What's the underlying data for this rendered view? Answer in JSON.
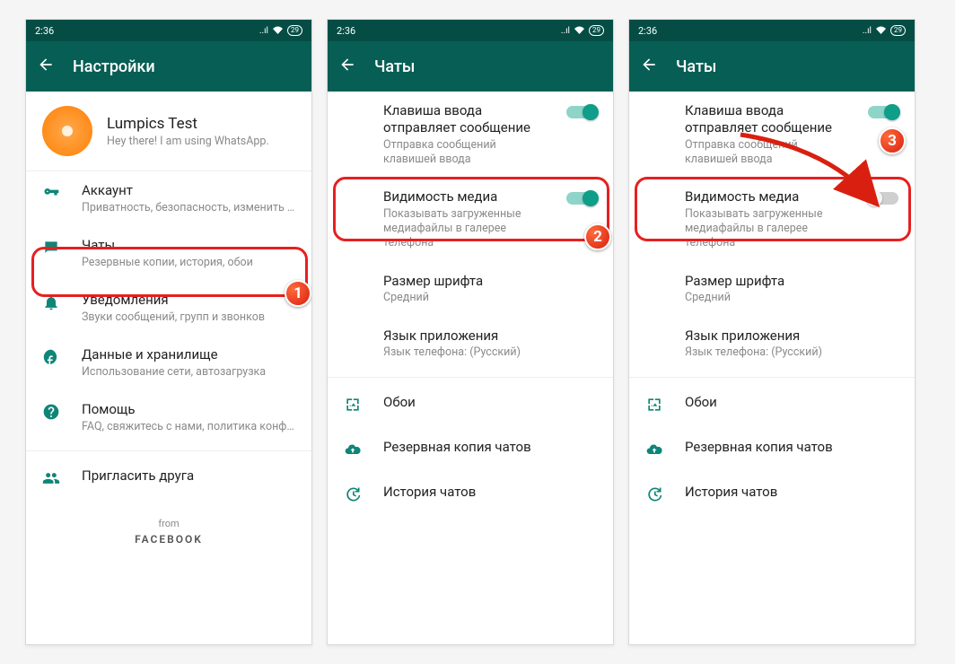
{
  "status": {
    "time": "2:36",
    "battery": "29"
  },
  "screen1": {
    "title": "Настройки",
    "profile": {
      "name": "Lumpics Test",
      "sub": "Hey there! I am using WhatsApp."
    },
    "items": [
      {
        "title": "Аккаунт",
        "sub": "Приватность, безопасность, изменить номер"
      },
      {
        "title": "Чаты",
        "sub": "Резервные копии, история, обои"
      },
      {
        "title": "Уведомления",
        "sub": "Звуки сообщений, групп и звонков"
      },
      {
        "title": "Данные и хранилище",
        "sub": "Использование сети, автозагрузка"
      },
      {
        "title": "Помощь",
        "sub": "FAQ, свяжитесь с нами, политика конфиденциальн..."
      },
      {
        "title": "Пригласить друга",
        "sub": ""
      }
    ],
    "footer_from": "from",
    "footer_fb": "FACEBOOK"
  },
  "screen2": {
    "title": "Чаты",
    "items": [
      {
        "title": "Клавиша ввода отправляет сообщение",
        "sub": "Отправка сообщений клавишей ввода",
        "toggle": "on"
      },
      {
        "title": "Видимость медиа",
        "sub": "Показывать загруженные медиафайлы в галерее телефона",
        "toggle": "on"
      },
      {
        "title": "Размер шрифта",
        "sub": "Средний"
      },
      {
        "title": "Язык приложения",
        "sub": "Язык телефона: (Русский)"
      }
    ],
    "menu": [
      {
        "title": "Обои"
      },
      {
        "title": "Резервная копия чатов"
      },
      {
        "title": "История чатов"
      }
    ]
  },
  "screen3": {
    "title": "Чаты",
    "items": [
      {
        "title": "Клавиша ввода отправляет сообщение",
        "sub": "Отправка сообщений клавишей ввода",
        "toggle": "on"
      },
      {
        "title": "Видимость медиа",
        "sub": "Показывать загруженные медиафайлы в галерее телефона",
        "toggle": "off"
      },
      {
        "title": "Размер шрифта",
        "sub": "Средний"
      },
      {
        "title": "Язык приложения",
        "sub": "Язык телефона: (Русский)"
      }
    ],
    "menu": [
      {
        "title": "Обои"
      },
      {
        "title": "Резервная копия чатов"
      },
      {
        "title": "История чатов"
      }
    ]
  },
  "badges": {
    "b1": "1",
    "b2": "2",
    "b3": "3"
  }
}
